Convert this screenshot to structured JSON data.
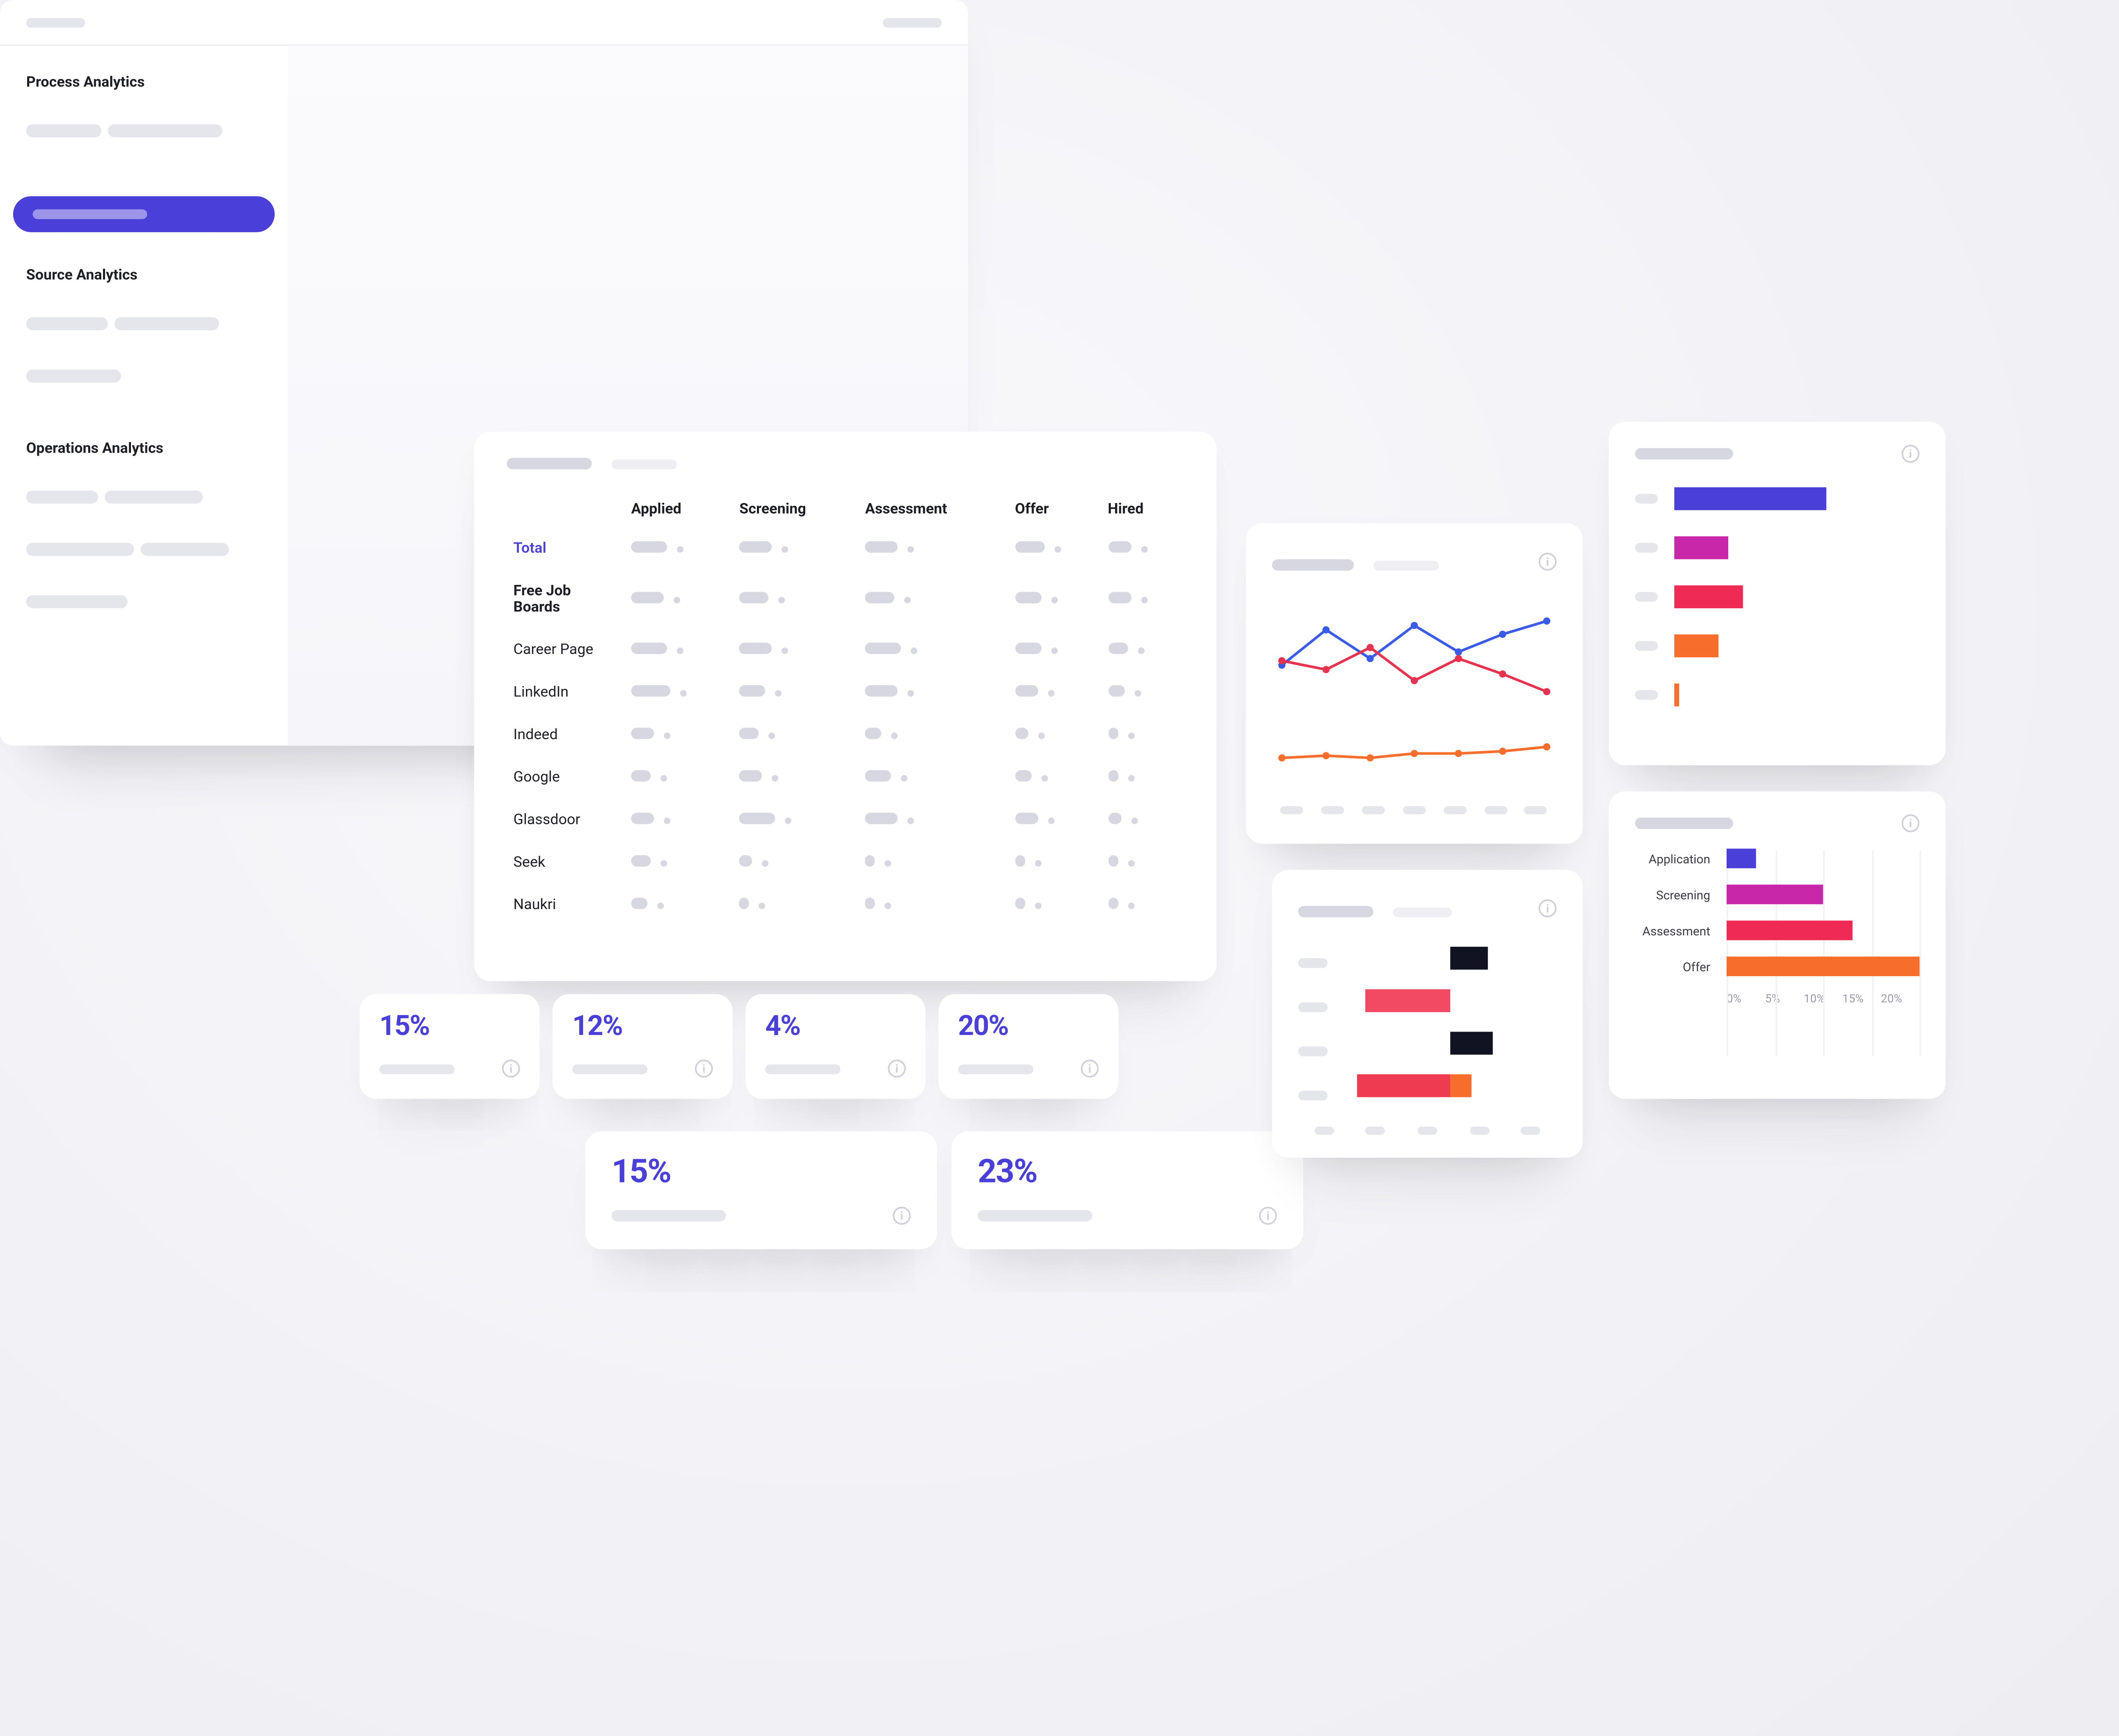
{
  "sidebar": {
    "sections": [
      {
        "title": "Process Analytics"
      },
      {
        "title": "Source Analytics"
      },
      {
        "title": "Operations Analytics"
      }
    ]
  },
  "funnel": {
    "columns": [
      "Applied",
      "Screening",
      "Assessment",
      "Offer",
      "Hired"
    ],
    "rows": [
      {
        "label": "Total",
        "kind": "total"
      },
      {
        "label": "Free Job Boards",
        "kind": "bold"
      },
      {
        "label": "Career Page"
      },
      {
        "label": "LinkedIn"
      },
      {
        "label": "Indeed"
      },
      {
        "label": "Google"
      },
      {
        "label": "Glassdoor"
      },
      {
        "label": "Seek"
      },
      {
        "label": "Naukri"
      }
    ]
  },
  "stats": [
    {
      "value": "15%"
    },
    {
      "value": "12%"
    },
    {
      "value": "4%"
    },
    {
      "value": "20%"
    },
    {
      "value": "15%"
    },
    {
      "value": "23%"
    }
  ],
  "tth_chart": {
    "labels": [
      "Application",
      "Screening",
      "Assessment",
      "Offer"
    ],
    "xticks": [
      "0%",
      "5%",
      "10%",
      "15%",
      "20%"
    ]
  },
  "chart_data": [
    {
      "id": "line_chart",
      "type": "line",
      "x": [
        1,
        2,
        3,
        4,
        5,
        6,
        7
      ],
      "series": [
        {
          "name": "blue",
          "color": "#3a5ae8",
          "values": [
            52,
            68,
            55,
            70,
            58,
            66,
            72
          ]
        },
        {
          "name": "red",
          "color": "#e7334f",
          "values": [
            54,
            50,
            60,
            45,
            55,
            48,
            40
          ]
        },
        {
          "name": "orange",
          "color": "#f76d2b",
          "values": [
            10,
            11,
            10,
            12,
            12,
            13,
            15
          ]
        }
      ],
      "ylim": [
        0,
        80
      ]
    },
    {
      "id": "tornado_chart",
      "type": "bar_diverging",
      "rows": [
        {
          "neg": {
            "w": 0,
            "color": null
          },
          "pos": {
            "w": 18,
            "color": "#111322"
          }
        },
        {
          "neg": {
            "w": 40,
            "color": "#f24a62"
          },
          "pos": {
            "w": 0,
            "color": null
          }
        },
        {
          "neg": {
            "w": 0,
            "color": null
          },
          "pos": {
            "w": 20,
            "color": "#111322"
          }
        },
        {
          "neg": {
            "w": 44,
            "color": "#ef3b52"
          },
          "pos": {
            "w": 10,
            "color": "#f76d2b"
          }
        }
      ],
      "range": [
        -50,
        50
      ]
    },
    {
      "id": "mini_hbar",
      "type": "bar_h",
      "max": 100,
      "bars": [
        {
          "w": 62,
          "color": "#4a3fd9"
        },
        {
          "w": 22,
          "color": "#c827a9"
        },
        {
          "w": 28,
          "color": "#ef2a55"
        },
        {
          "w": 18,
          "color": "#f76d2b"
        },
        {
          "w": 2,
          "color": "#f76d2b"
        }
      ]
    },
    {
      "id": "time_to_hire",
      "type": "bar_h",
      "categories": [
        "Application",
        "Screening",
        "Assessment",
        "Offer"
      ],
      "values": [
        3,
        10,
        13,
        20
      ],
      "colors": [
        "#4a3fd9",
        "#c827a9",
        "#ef2a55",
        "#f76d2b"
      ],
      "xlim": [
        0,
        20
      ],
      "xticks": [
        0,
        5,
        10,
        15,
        20
      ],
      "xtick_labels": [
        "0%",
        "5%",
        "10%",
        "15%",
        "20%"
      ]
    }
  ]
}
